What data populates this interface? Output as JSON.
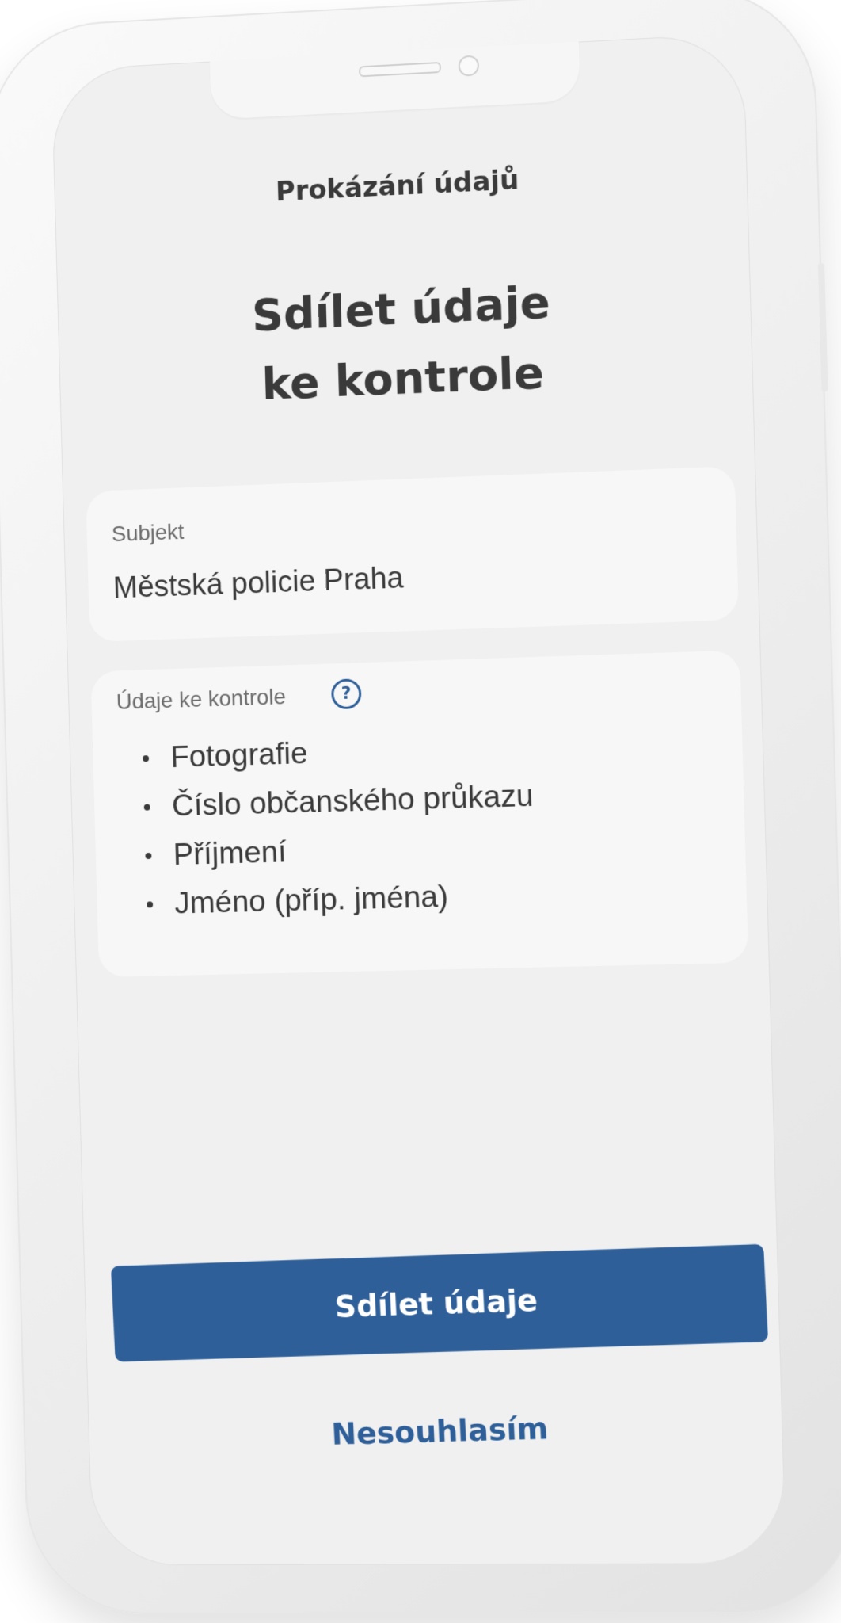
{
  "header": {
    "title": "Prokázání údajů"
  },
  "main": {
    "heading_line1": "Sdílet údaje",
    "heading_line2": "ke kontrole",
    "subject": {
      "label": "Subjekt",
      "value": "Městská policie Praha"
    },
    "data_section": {
      "label": "Údaje ke kontrole",
      "help_icon": "question-circle-icon",
      "help_glyph": "?",
      "items": [
        "Fotografie",
        "Číslo občanského průkazu",
        "Příjmení",
        "Jméno (příp. jména)"
      ]
    }
  },
  "actions": {
    "share_label": "Sdílet údaje",
    "decline_label": "Nesouhlasím"
  },
  "colors": {
    "accent": "#2e5f99",
    "screen_bg": "#f0f0f0",
    "card_bg": "#f7f7f7",
    "text": "#3a3a3a",
    "muted_text": "#6b6b6b"
  }
}
